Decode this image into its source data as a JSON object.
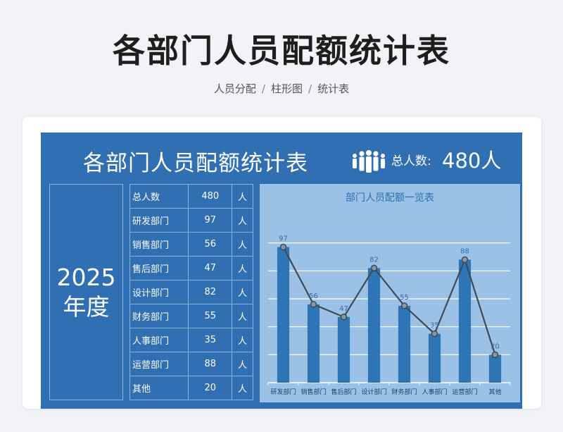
{
  "page": {
    "title": "各部门人员配额统计表",
    "breadcrumb": [
      "人员分配",
      "柱形图",
      "统计表"
    ],
    "separator": "/"
  },
  "sheet": {
    "title": "各部门人员配额统计表",
    "total_label": "总人数:",
    "total_value": "480人",
    "year": "2025",
    "year_suffix": "年度",
    "icon": "people-group-icon",
    "colors": {
      "background": "#2f6fb2",
      "panel": "#9bc2e6",
      "bar": "#2e75b6",
      "line": "#404a55"
    }
  },
  "table": {
    "rows": [
      {
        "name": "总人数",
        "value": "480",
        "unit": "人"
      },
      {
        "name": "研发部门",
        "value": "97",
        "unit": "人"
      },
      {
        "name": "销售部门",
        "value": "56",
        "unit": "人"
      },
      {
        "name": "售后部门",
        "value": "47",
        "unit": "人"
      },
      {
        "name": "设计部门",
        "value": "82",
        "unit": "人"
      },
      {
        "name": "财务部门",
        "value": "55",
        "unit": "人"
      },
      {
        "name": "人事部门",
        "value": "35",
        "unit": "人"
      },
      {
        "name": "运营部门",
        "value": "88",
        "unit": "人"
      },
      {
        "name": "其他",
        "value": "20",
        "unit": "人"
      }
    ]
  },
  "chart_data": {
    "type": "bar",
    "title": "部门人员配额一览表",
    "categories": [
      "研发部门",
      "销售部门",
      "售后部门",
      "设计部门",
      "财务部门",
      "人事部门",
      "运营部门",
      "其他"
    ],
    "values": [
      97,
      56,
      47,
      82,
      55,
      35,
      88,
      20
    ],
    "overlay": "line",
    "ylim": [
      0,
      120
    ],
    "grid": true,
    "data_labels": true
  }
}
